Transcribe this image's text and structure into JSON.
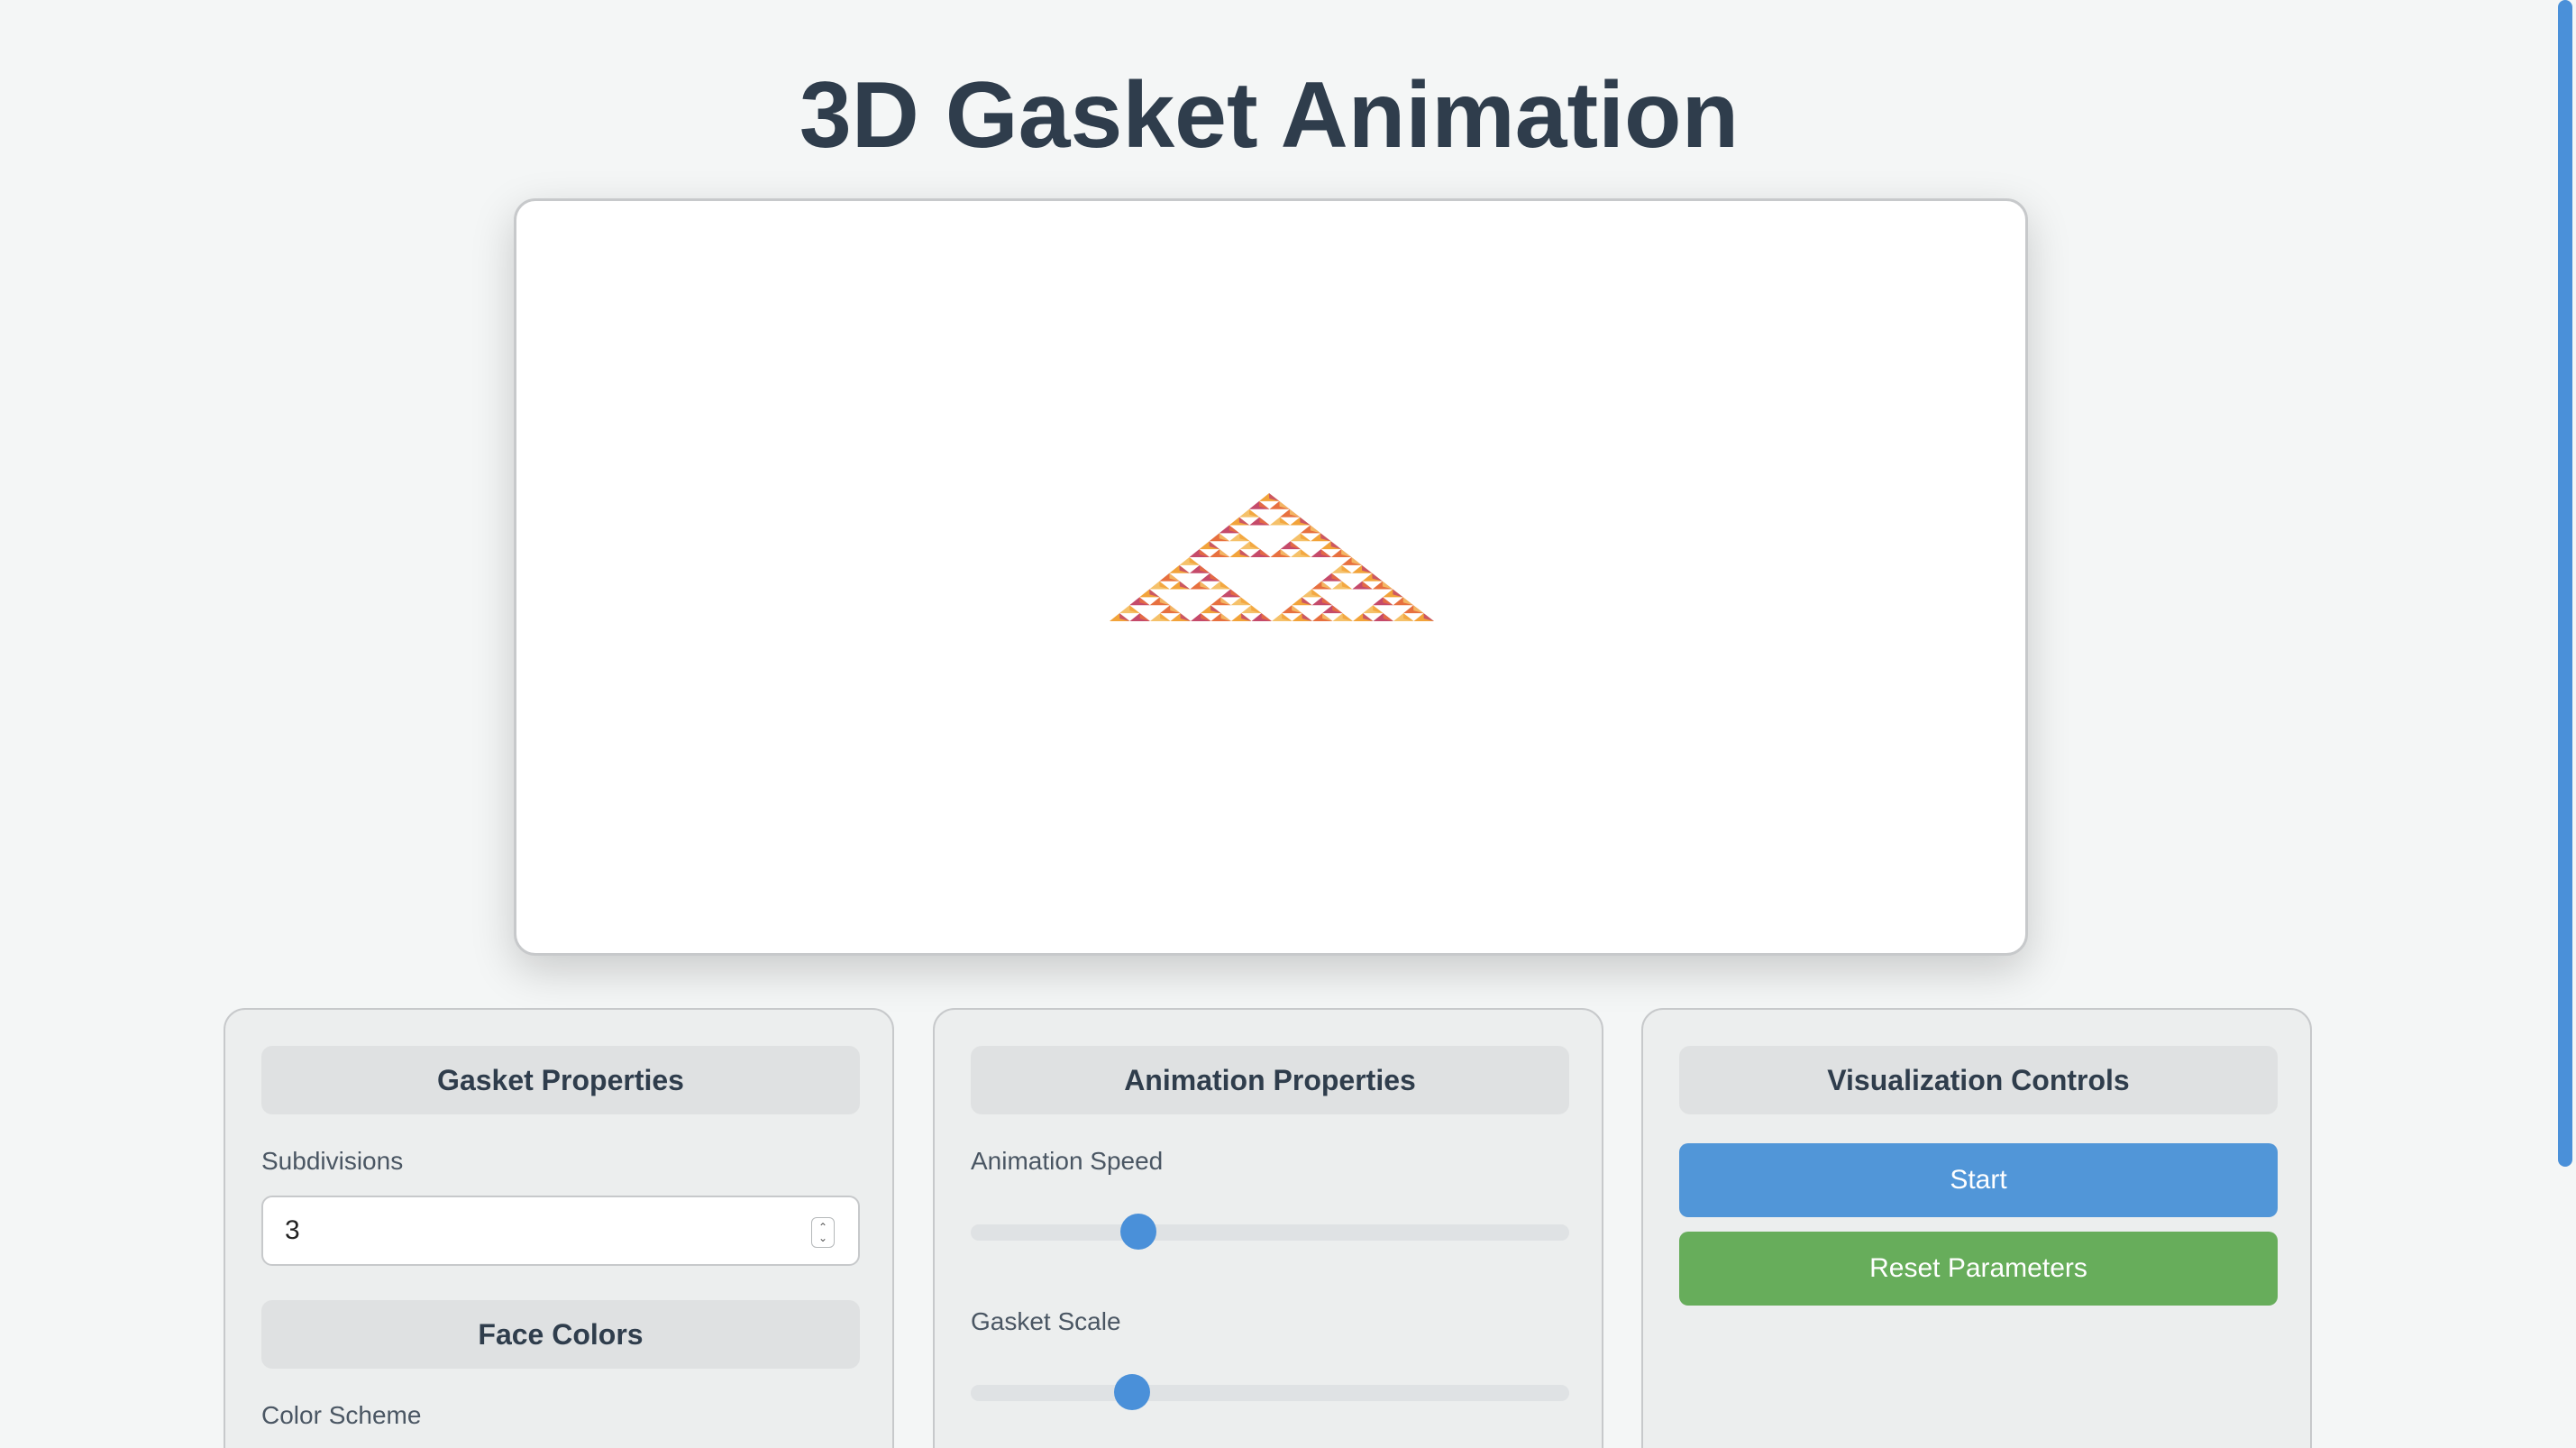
{
  "page": {
    "title": "3D Gasket Animation"
  },
  "gasket": {
    "subdivisions": 3,
    "colors": [
      "#f2a33a",
      "#c54a6a",
      "#e7703f",
      "#f5c16a"
    ]
  },
  "panels": {
    "gasket_properties": {
      "header": "Gasket Properties",
      "subdivisions_label": "Subdivisions",
      "subdivisions_value": "3",
      "face_colors_header": "Face Colors",
      "color_scheme_label": "Color Scheme"
    },
    "animation_properties": {
      "header": "Animation Properties",
      "speed_label": "Animation Speed",
      "speed_value": 0.28,
      "scale_label": "Gasket Scale",
      "scale_value": 0.27
    },
    "visualization_controls": {
      "header": "Visualization Controls",
      "start_label": "Start",
      "reset_label": "Reset Parameters"
    }
  },
  "colors": {
    "accent": "#4a90d9",
    "start_button": "#5196d8",
    "reset_button": "#67ad5b"
  }
}
